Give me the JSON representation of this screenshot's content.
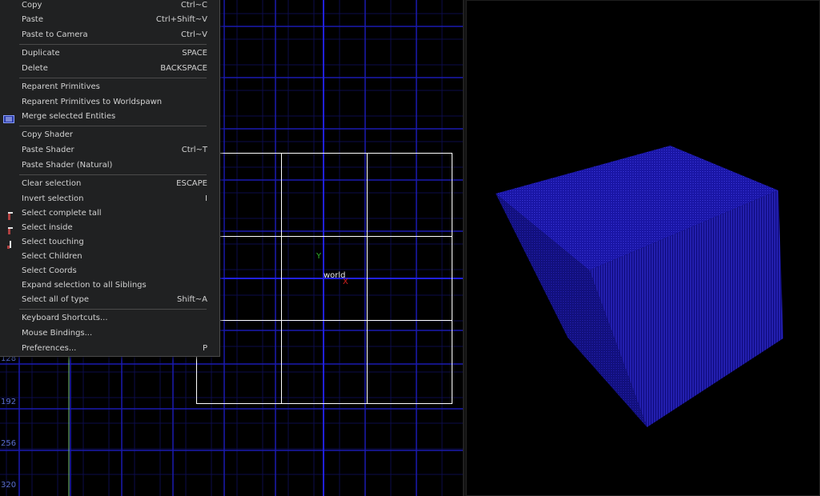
{
  "menu": {
    "items": [
      {
        "label": "Copy",
        "shortcut": "Ctrl~C"
      },
      {
        "label": "Paste",
        "shortcut": "Ctrl+Shift~V"
      },
      {
        "label": "Paste to Camera",
        "shortcut": "Ctrl~V"
      },
      {
        "label": "Duplicate",
        "shortcut": "SPACE"
      },
      {
        "label": "Delete",
        "shortcut": "BACKSPACE"
      },
      {
        "label": "Reparent Primitives",
        "shortcut": ""
      },
      {
        "label": "Reparent Primitives to Worldspawn",
        "shortcut": ""
      },
      {
        "label": "Merge selected Entities",
        "shortcut": "",
        "icon": "merge-entities-icon"
      },
      {
        "label": "Copy Shader",
        "shortcut": ""
      },
      {
        "label": "Paste Shader",
        "shortcut": "Ctrl~T"
      },
      {
        "label": "Paste Shader (Natural)",
        "shortcut": ""
      },
      {
        "label": "Clear selection",
        "shortcut": "ESCAPE"
      },
      {
        "label": "Invert selection",
        "shortcut": "I"
      },
      {
        "label": "Select complete tall",
        "shortcut": "",
        "icon": "select-complete-tall-icon"
      },
      {
        "label": "Select inside",
        "shortcut": "",
        "icon": "select-inside-icon"
      },
      {
        "label": "Select touching",
        "shortcut": "",
        "icon": "select-touching-icon"
      },
      {
        "label": "Select Children",
        "shortcut": ""
      },
      {
        "label": "Select Coords",
        "shortcut": ""
      },
      {
        "label": "Expand selection to all Siblings",
        "shortcut": ""
      },
      {
        "label": "Select all of type",
        "shortcut": "Shift~A"
      },
      {
        "label": "Keyboard Shortcuts...",
        "shortcut": ""
      },
      {
        "label": "Mouse Bindings...",
        "shortcut": ""
      },
      {
        "label": "Preferences...",
        "shortcut": "P"
      }
    ]
  },
  "ortho": {
    "coords": [
      "128",
      "192",
      "256",
      "320"
    ],
    "origin_label": "world",
    "axis_y": "Y",
    "axis_x": "X"
  },
  "colors": {
    "grid_major": "#1414c8",
    "grid_minor": "#0c0c4a",
    "brush": "#ffffff",
    "cube": "#1a14a8",
    "axis_y": "#2fb52f",
    "axis_x": "#d02020"
  }
}
